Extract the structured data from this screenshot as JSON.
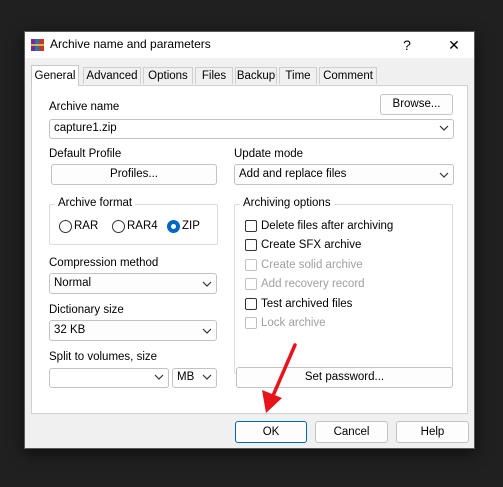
{
  "window": {
    "title": "Archive name and parameters",
    "help_glyph": "?",
    "close_glyph": "✕"
  },
  "tabs": [
    {
      "label": "General",
      "active": true
    },
    {
      "label": "Advanced"
    },
    {
      "label": "Options"
    },
    {
      "label": "Files"
    },
    {
      "label": "Backup"
    },
    {
      "label": "Time"
    },
    {
      "label": "Comment"
    }
  ],
  "archive_name": {
    "label": "Archive name",
    "value": "capture1.zip",
    "browse_label": "Browse..."
  },
  "default_profile": {
    "label": "Default Profile",
    "profiles_label": "Profiles..."
  },
  "update_mode": {
    "label": "Update mode",
    "value": "Add and replace files"
  },
  "archive_format": {
    "label": "Archive format",
    "options": [
      "RAR",
      "RAR4",
      "ZIP"
    ],
    "selected": "ZIP"
  },
  "archiving_options": {
    "label": "Archiving options",
    "items": [
      {
        "label": "Delete files after archiving",
        "checked": false,
        "enabled": true
      },
      {
        "label": "Create SFX archive",
        "checked": false,
        "enabled": true
      },
      {
        "label": "Create solid archive",
        "checked": false,
        "enabled": false
      },
      {
        "label": "Add recovery record",
        "checked": false,
        "enabled": false
      },
      {
        "label": "Test archived files",
        "checked": false,
        "enabled": true
      },
      {
        "label": "Lock archive",
        "checked": false,
        "enabled": false
      }
    ]
  },
  "compression_method": {
    "label": "Compression method",
    "value": "Normal"
  },
  "dictionary_size": {
    "label": "Dictionary size",
    "value": "32 KB"
  },
  "split_volumes": {
    "label": "Split to volumes, size",
    "value": "",
    "unit": "MB"
  },
  "set_password_label": "Set password...",
  "footer": {
    "ok": "OK",
    "cancel": "Cancel",
    "help": "Help"
  },
  "colors": {
    "accent": "#0067c0",
    "annotation_arrow": "#e8141b"
  }
}
